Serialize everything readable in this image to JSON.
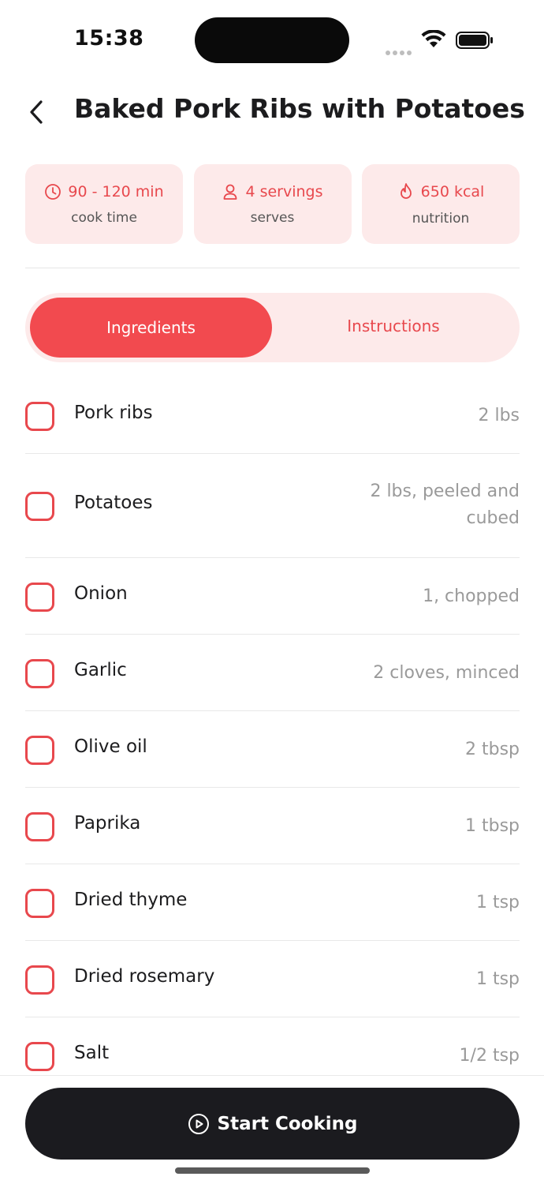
{
  "status_bar": {
    "time": "15:38"
  },
  "header": {
    "title": "Baked Pork Ribs with Potatoes"
  },
  "info_cards": [
    {
      "value": "90 - 120 min",
      "label": "cook time",
      "icon": "clock-icon"
    },
    {
      "value": "4 servings",
      "label": "serves",
      "icon": "person-icon"
    },
    {
      "value": "650 kcal",
      "label": "nutrition",
      "icon": "flame-icon"
    }
  ],
  "tabs": [
    {
      "label": "Ingredients",
      "active": true
    },
    {
      "label": "Instructions",
      "active": false
    }
  ],
  "ingredients": [
    {
      "name": "Pork ribs",
      "amount": "2 lbs",
      "checked": false
    },
    {
      "name": "Potatoes",
      "amount": "2 lbs, peeled and cubed",
      "checked": false
    },
    {
      "name": "Onion",
      "amount": "1, chopped",
      "checked": false
    },
    {
      "name": "Garlic",
      "amount": "2 cloves, minced",
      "checked": false
    },
    {
      "name": "Olive oil",
      "amount": "2 tbsp",
      "checked": false
    },
    {
      "name": "Paprika",
      "amount": "1 tbsp",
      "checked": false
    },
    {
      "name": "Dried thyme",
      "amount": "1 tsp",
      "checked": false
    },
    {
      "name": "Dried rosemary",
      "amount": "1 tsp",
      "checked": false
    },
    {
      "name": "Salt",
      "amount": "1/2 tsp",
      "checked": false
    }
  ],
  "actions": {
    "start_label": "Start Cooking",
    "start_icon": "play-circle-icon"
  },
  "colors": {
    "accent": "#f24a4f",
    "accent_soft": "#fdeaea",
    "button_dark": "#1b1b1f"
  }
}
